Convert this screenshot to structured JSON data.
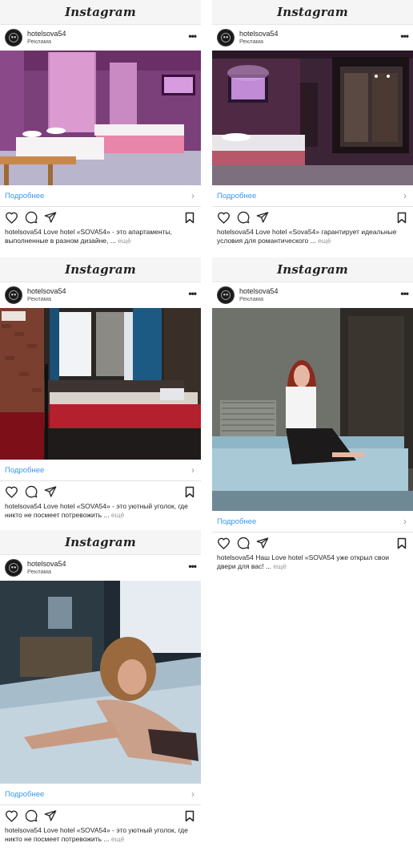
{
  "brand": "Instagram",
  "posts": [
    {
      "username": "hotelsova54",
      "sponsored": "Реклама",
      "more": "•••",
      "cta": "Подробнее",
      "caption": "hotelsova54 Love hotel «SOVA54» - это апартаменты, выполненные в разном дизайне, ...",
      "more_link": "ещё"
    },
    {
      "username": "hotelsova54",
      "sponsored": "Реклама",
      "more": "•••",
      "cta": "Подробнее",
      "caption": "hotelsova54 Love hotel «Sova54» гарантирует идеальные условия для романтического ...",
      "more_link": "ещё"
    },
    {
      "username": "hotelsova54",
      "sponsored": "Реклама",
      "more": "•••",
      "cta": "Подробнее",
      "caption": "hotelsova54 Love hotel «SOVA54» - это уютный уголок, где никто не посмеет потревожить ...",
      "more_link": "ещё"
    },
    {
      "username": "hotelsova54",
      "sponsored": "Реклама",
      "more": "•••",
      "cta": "Подробнее",
      "caption": "hotelsova54 Наш Love hotel «SOVA54 уже открыл свои двери для вас! ...",
      "more_link": "ещё"
    },
    {
      "username": "hotelsova54",
      "sponsored": "Реклама",
      "more": "•••",
      "cta": "Подробнее",
      "caption": "hotelsova54 Love hotel «SOVA54» - это уютный уголок, где никто не посмеет потревожить ...",
      "more_link": "ещё"
    }
  ],
  "icons": {
    "like": "heart-icon",
    "comment": "comment-icon",
    "share": "send-icon",
    "save": "bookmark-icon",
    "cta": "chevron-right-icon"
  },
  "colors": {
    "link": "#3897f0",
    "text": "#262626",
    "muted": "#999999",
    "topbar": "#f5f5f5"
  }
}
